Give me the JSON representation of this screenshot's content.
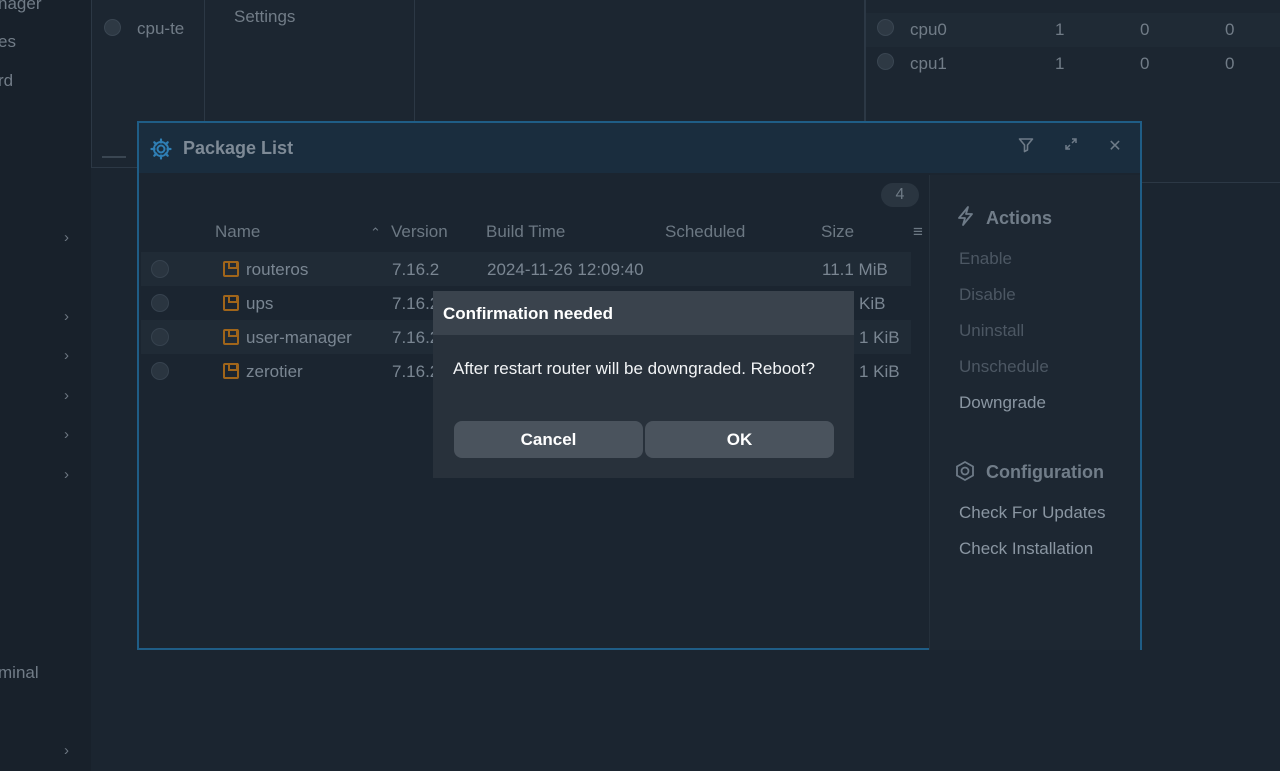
{
  "sidebar": {
    "items": [
      "nager",
      "es",
      "rd",
      "minal"
    ]
  },
  "background": {
    "left_window": {
      "row_label": "cpu-te",
      "tab_label": "Settings"
    },
    "right_window": {
      "rows": [
        {
          "name": "cpu0",
          "c1": "1",
          "c2": "0",
          "c3": "0"
        },
        {
          "name": "cpu1",
          "c1": "1",
          "c2": "0",
          "c3": "0"
        }
      ]
    }
  },
  "package_list": {
    "title": "Package List",
    "count": "4",
    "columns": {
      "name": "Name",
      "version": "Version",
      "build_time": "Build Time",
      "scheduled": "Scheduled",
      "size": "Size"
    },
    "rows": [
      {
        "name": "routeros",
        "version": "7.16.2",
        "build_time": "2024-11-26 12:09:40",
        "scheduled": "",
        "size": "11.1 MiB"
      },
      {
        "name": "ups",
        "version": "7.16.2",
        "build_time": "",
        "scheduled": "",
        "size": "KiB"
      },
      {
        "name": "user-manager",
        "version": "7.16.2",
        "build_time": "",
        "scheduled": "",
        "size": "1 KiB"
      },
      {
        "name": "zerotier",
        "version": "7.16.2",
        "build_time": "",
        "scheduled": "",
        "size": "1 KiB"
      }
    ],
    "actions": {
      "heading": "Actions",
      "items": [
        "Enable",
        "Disable",
        "Uninstall",
        "Unschedule",
        "Downgrade"
      ]
    },
    "configuration": {
      "heading": "Configuration",
      "items": [
        "Check For Updates",
        "Check Installation"
      ]
    }
  },
  "modal": {
    "title": "Confirmation needed",
    "message": "After restart router will be downgraded. Reboot?",
    "cancel_label": "Cancel",
    "ok_label": "OK"
  },
  "colors": {
    "window_border": "#1f5d86",
    "package_icon": "#a0651a",
    "modal_bg": "#28313b"
  }
}
